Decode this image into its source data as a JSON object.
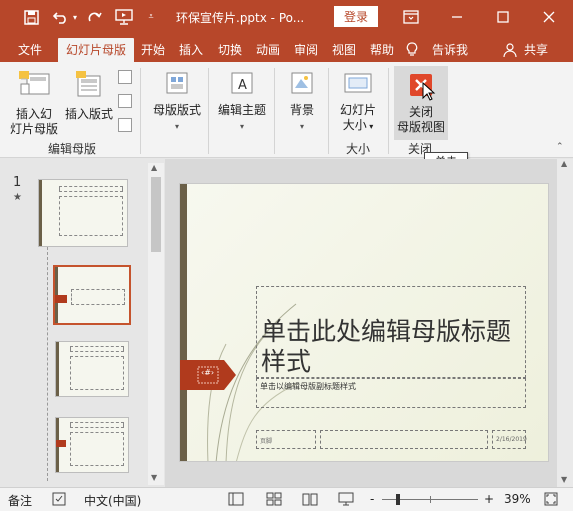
{
  "titlebar": {
    "title": "环保宣传片.pptx  -  Po...",
    "login_label": "登录",
    "icons": [
      "save-icon",
      "undo-icon",
      "redo-icon",
      "present-icon",
      "customize-icon",
      "ribbon-display-icon",
      "minimize-icon",
      "restore-icon",
      "close-icon"
    ]
  },
  "tabs": [
    {
      "label": "文件",
      "active": false
    },
    {
      "label": "幻灯片母版",
      "active": true
    },
    {
      "label": "开始",
      "active": false
    },
    {
      "label": "插入",
      "active": false
    },
    {
      "label": "切换",
      "active": false
    },
    {
      "label": "动画",
      "active": false
    },
    {
      "label": "审阅",
      "active": false
    },
    {
      "label": "视图",
      "active": false
    },
    {
      "label": "帮助",
      "active": false
    },
    {
      "label": "告诉我",
      "active": false
    },
    {
      "label": "共享",
      "active": false
    }
  ],
  "ribbon": {
    "insert_slide_master_line1": "插入幻",
    "insert_slide_master_line2": "灯片母版",
    "insert_layout": "插入版式",
    "master_layout": "母版版式",
    "edit_theme": "编辑主题",
    "background": "背景",
    "slide_size_line1": "幻灯片",
    "slide_size_line2": "大小",
    "close_master_line1": "关闭",
    "close_master_line2": "母版视图",
    "group_edit_master": "编辑母版",
    "group_size": "大小",
    "group_close": "关闭",
    "accent_color": "#b7472a",
    "close_icon_color": "#e0472a"
  },
  "tooltip": {
    "text": "单击"
  },
  "thumbnails": {
    "slide_number": "1",
    "star": "★"
  },
  "slide": {
    "title_text": "单击此处编辑母版标题样式",
    "subtitle_text": "单击以编辑母版副标题样式",
    "date_text": "2/16/2019",
    "footer_text": "页脚",
    "number_text": "‹#›"
  },
  "statusbar": {
    "notes": "备注",
    "language": "中文(中国)",
    "zoom_minus": "-",
    "zoom_plus": "+",
    "zoom": "39%"
  }
}
